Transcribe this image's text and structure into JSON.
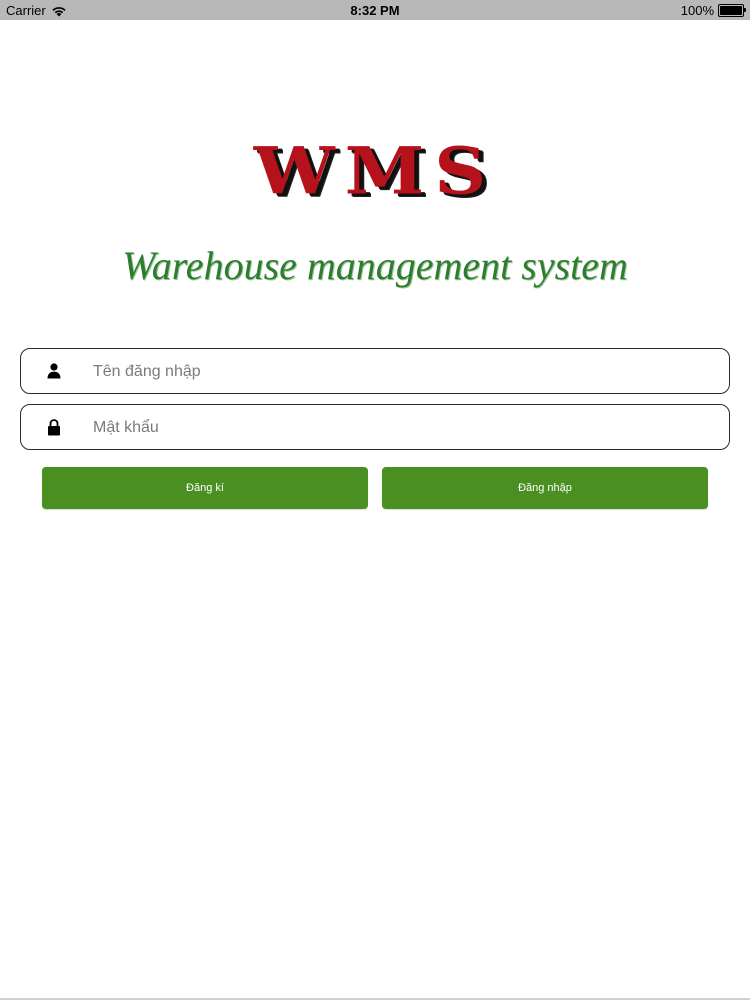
{
  "status_bar": {
    "carrier": "Carrier",
    "time": "8:32 PM",
    "battery": "100%",
    "battery_level": 1.0
  },
  "logo": {
    "text": "WMS",
    "color": "#b5121b"
  },
  "subtitle": {
    "text": "Warehouse management system",
    "color": "#2e7d2e"
  },
  "form": {
    "username": {
      "value": "",
      "placeholder": "Tên đăng nhập",
      "icon": "user-icon"
    },
    "password": {
      "value": "",
      "placeholder": "Mật khẩu",
      "icon": "lock-icon"
    }
  },
  "buttons": {
    "register_label": "Đăng kí",
    "login_label": "Đăng nhập",
    "color": "#4a8f22"
  }
}
